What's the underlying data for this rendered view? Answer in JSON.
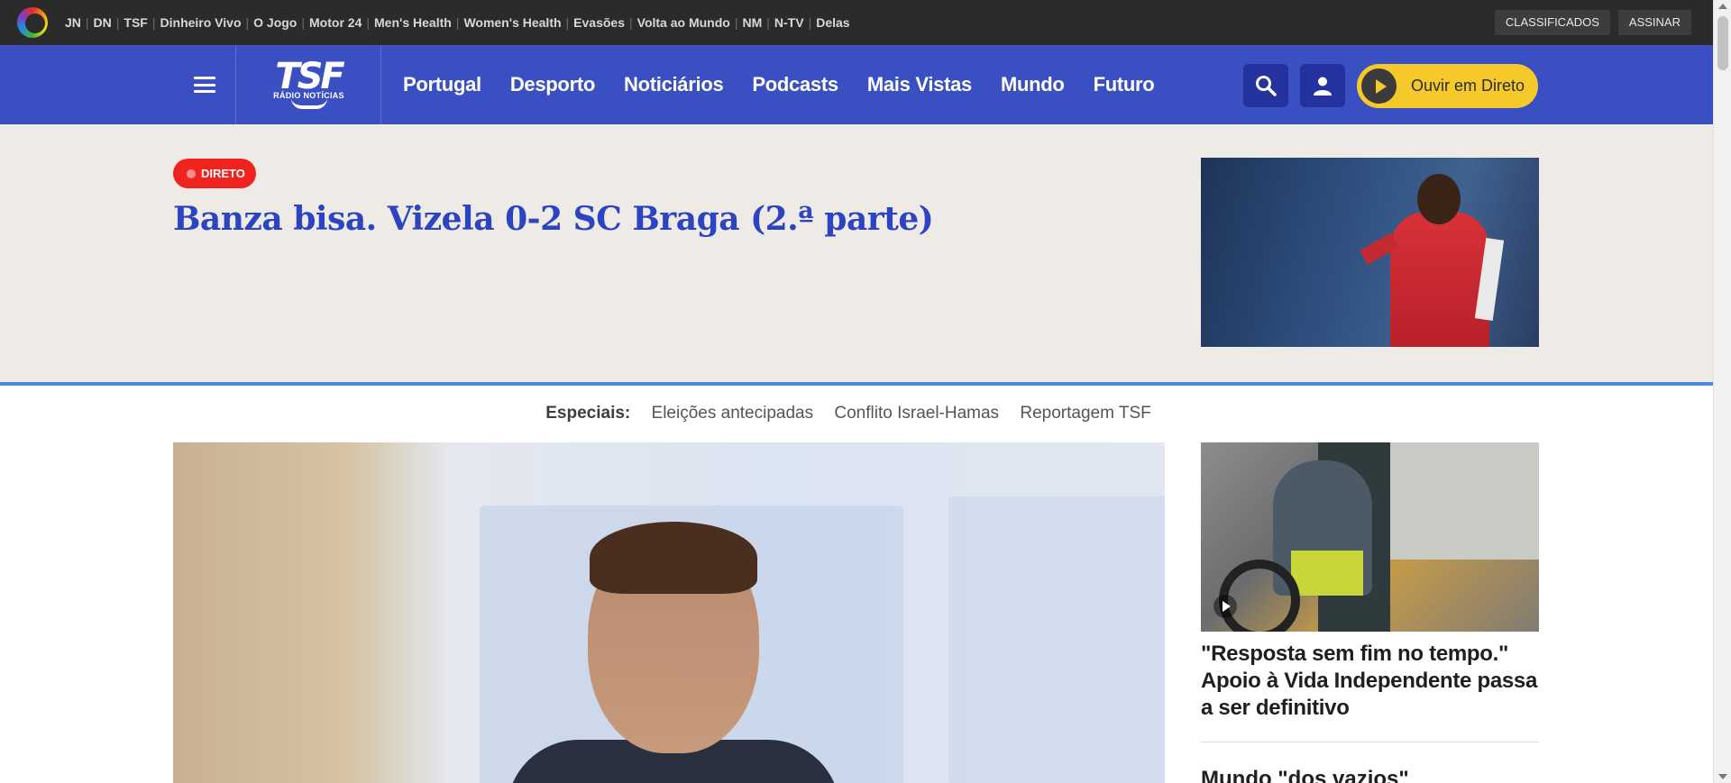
{
  "network": {
    "links": [
      "JN",
      "DN",
      "TSF",
      "Dinheiro Vivo",
      "O Jogo",
      "Motor 24",
      "Men's Health",
      "Women's Health",
      "Evasões",
      "Volta ao Mundo",
      "NM",
      "N-TV",
      "Delas"
    ],
    "classificados": "CLASSIFICADOS",
    "assinar": "ASSINAR"
  },
  "brand": {
    "mark": "TSF",
    "sub": "RÁDIO NOTÍCIAS"
  },
  "nav": {
    "items": [
      "Portugal",
      "Desporto",
      "Noticiários",
      "Podcasts",
      "Mais Vistas",
      "Mundo",
      "Futuro"
    ],
    "live_button": "Ouvir em Direto"
  },
  "live": {
    "badge": "DIRETO",
    "headline": "Banza bisa. Vizela 0-2 SC Braga (2.ª parte)"
  },
  "specials": {
    "label": "Especiais:",
    "items": [
      "Eleições antecipadas",
      "Conflito Israel-Hamas",
      "Reportagem TSF"
    ]
  },
  "side_story": {
    "headline": "\"Resposta sem fim no tempo.\" Apoio à Vida Independente passa a ser definitivo",
    "next_headline": "Mundo \"dos vazios\""
  },
  "colors": {
    "nav_blue": "#3a4fc2",
    "headline_blue": "#2d44c0",
    "live_red": "#f0241e",
    "listen_yellow": "#f5c92a"
  }
}
